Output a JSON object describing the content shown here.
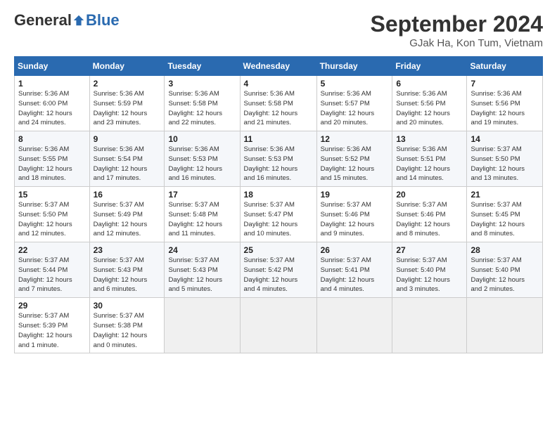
{
  "header": {
    "logo_general": "General",
    "logo_blue": "Blue",
    "month_title": "September 2024",
    "subtitle": "GJak Ha, Kon Tum, Vietnam"
  },
  "columns": [
    "Sunday",
    "Monday",
    "Tuesday",
    "Wednesday",
    "Thursday",
    "Friday",
    "Saturday"
  ],
  "weeks": [
    [
      {
        "day": "1",
        "info": "Sunrise: 5:36 AM\nSunset: 6:00 PM\nDaylight: 12 hours\nand 24 minutes."
      },
      {
        "day": "2",
        "info": "Sunrise: 5:36 AM\nSunset: 5:59 PM\nDaylight: 12 hours\nand 23 minutes."
      },
      {
        "day": "3",
        "info": "Sunrise: 5:36 AM\nSunset: 5:58 PM\nDaylight: 12 hours\nand 22 minutes."
      },
      {
        "day": "4",
        "info": "Sunrise: 5:36 AM\nSunset: 5:58 PM\nDaylight: 12 hours\nand 21 minutes."
      },
      {
        "day": "5",
        "info": "Sunrise: 5:36 AM\nSunset: 5:57 PM\nDaylight: 12 hours\nand 20 minutes."
      },
      {
        "day": "6",
        "info": "Sunrise: 5:36 AM\nSunset: 5:56 PM\nDaylight: 12 hours\nand 20 minutes."
      },
      {
        "day": "7",
        "info": "Sunrise: 5:36 AM\nSunset: 5:56 PM\nDaylight: 12 hours\nand 19 minutes."
      }
    ],
    [
      {
        "day": "8",
        "info": "Sunrise: 5:36 AM\nSunset: 5:55 PM\nDaylight: 12 hours\nand 18 minutes."
      },
      {
        "day": "9",
        "info": "Sunrise: 5:36 AM\nSunset: 5:54 PM\nDaylight: 12 hours\nand 17 minutes."
      },
      {
        "day": "10",
        "info": "Sunrise: 5:36 AM\nSunset: 5:53 PM\nDaylight: 12 hours\nand 16 minutes."
      },
      {
        "day": "11",
        "info": "Sunrise: 5:36 AM\nSunset: 5:53 PM\nDaylight: 12 hours\nand 16 minutes."
      },
      {
        "day": "12",
        "info": "Sunrise: 5:36 AM\nSunset: 5:52 PM\nDaylight: 12 hours\nand 15 minutes."
      },
      {
        "day": "13",
        "info": "Sunrise: 5:36 AM\nSunset: 5:51 PM\nDaylight: 12 hours\nand 14 minutes."
      },
      {
        "day": "14",
        "info": "Sunrise: 5:37 AM\nSunset: 5:50 PM\nDaylight: 12 hours\nand 13 minutes."
      }
    ],
    [
      {
        "day": "15",
        "info": "Sunrise: 5:37 AM\nSunset: 5:50 PM\nDaylight: 12 hours\nand 12 minutes."
      },
      {
        "day": "16",
        "info": "Sunrise: 5:37 AM\nSunset: 5:49 PM\nDaylight: 12 hours\nand 12 minutes."
      },
      {
        "day": "17",
        "info": "Sunrise: 5:37 AM\nSunset: 5:48 PM\nDaylight: 12 hours\nand 11 minutes."
      },
      {
        "day": "18",
        "info": "Sunrise: 5:37 AM\nSunset: 5:47 PM\nDaylight: 12 hours\nand 10 minutes."
      },
      {
        "day": "19",
        "info": "Sunrise: 5:37 AM\nSunset: 5:46 PM\nDaylight: 12 hours\nand 9 minutes."
      },
      {
        "day": "20",
        "info": "Sunrise: 5:37 AM\nSunset: 5:46 PM\nDaylight: 12 hours\nand 8 minutes."
      },
      {
        "day": "21",
        "info": "Sunrise: 5:37 AM\nSunset: 5:45 PM\nDaylight: 12 hours\nand 8 minutes."
      }
    ],
    [
      {
        "day": "22",
        "info": "Sunrise: 5:37 AM\nSunset: 5:44 PM\nDaylight: 12 hours\nand 7 minutes."
      },
      {
        "day": "23",
        "info": "Sunrise: 5:37 AM\nSunset: 5:43 PM\nDaylight: 12 hours\nand 6 minutes."
      },
      {
        "day": "24",
        "info": "Sunrise: 5:37 AM\nSunset: 5:43 PM\nDaylight: 12 hours\nand 5 minutes."
      },
      {
        "day": "25",
        "info": "Sunrise: 5:37 AM\nSunset: 5:42 PM\nDaylight: 12 hours\nand 4 minutes."
      },
      {
        "day": "26",
        "info": "Sunrise: 5:37 AM\nSunset: 5:41 PM\nDaylight: 12 hours\nand 4 minutes."
      },
      {
        "day": "27",
        "info": "Sunrise: 5:37 AM\nSunset: 5:40 PM\nDaylight: 12 hours\nand 3 minutes."
      },
      {
        "day": "28",
        "info": "Sunrise: 5:37 AM\nSunset: 5:40 PM\nDaylight: 12 hours\nand 2 minutes."
      }
    ],
    [
      {
        "day": "29",
        "info": "Sunrise: 5:37 AM\nSunset: 5:39 PM\nDaylight: 12 hours\nand 1 minute."
      },
      {
        "day": "30",
        "info": "Sunrise: 5:37 AM\nSunset: 5:38 PM\nDaylight: 12 hours\nand 0 minutes."
      },
      null,
      null,
      null,
      null,
      null
    ]
  ]
}
